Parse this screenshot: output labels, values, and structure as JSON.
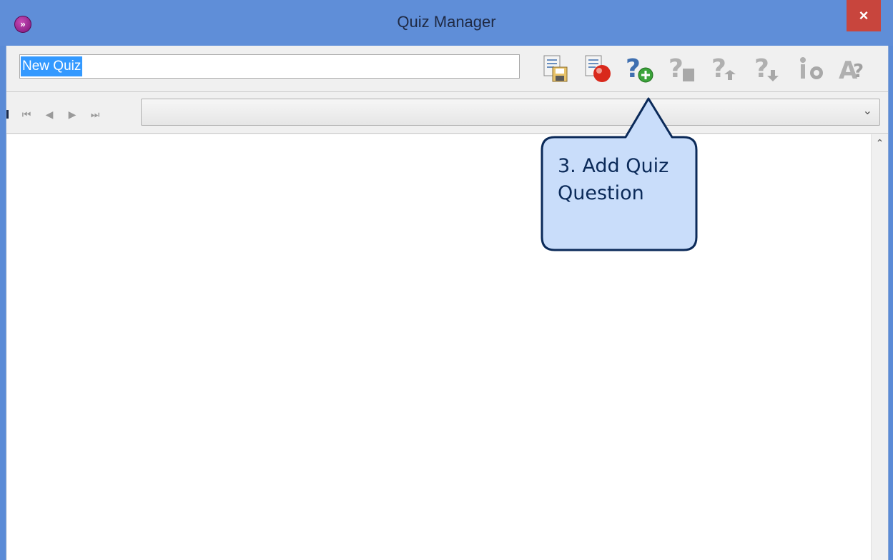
{
  "window": {
    "title": "Quiz Manager",
    "close_label": "×",
    "app_icon_glyph": "»"
  },
  "toolbar": {
    "quiz_name_value": "New Quiz",
    "icons": [
      {
        "name": "save-quiz-icon"
      },
      {
        "name": "delete-quiz-icon"
      },
      {
        "name": "add-question-icon"
      },
      {
        "name": "delete-question-icon"
      },
      {
        "name": "move-question-up-icon"
      },
      {
        "name": "move-question-down-icon"
      },
      {
        "name": "question-options-icon"
      },
      {
        "name": "answers-icon"
      }
    ]
  },
  "navigation": {
    "first": "⏮",
    "prev": "◀",
    "next": "▶",
    "last": "⏭",
    "question_select_value": "",
    "dropdown_glyph": "⌄"
  },
  "scrollbar": {
    "up_glyph": "⌃"
  },
  "callout": {
    "text": "3. Add Quiz Question"
  },
  "colors": {
    "title_bar": "#5f8ed8",
    "close_button": "#c8453d",
    "callout_fill": "#c9ddfa",
    "callout_border": "#0b2a59",
    "selection": "#3399ff"
  }
}
